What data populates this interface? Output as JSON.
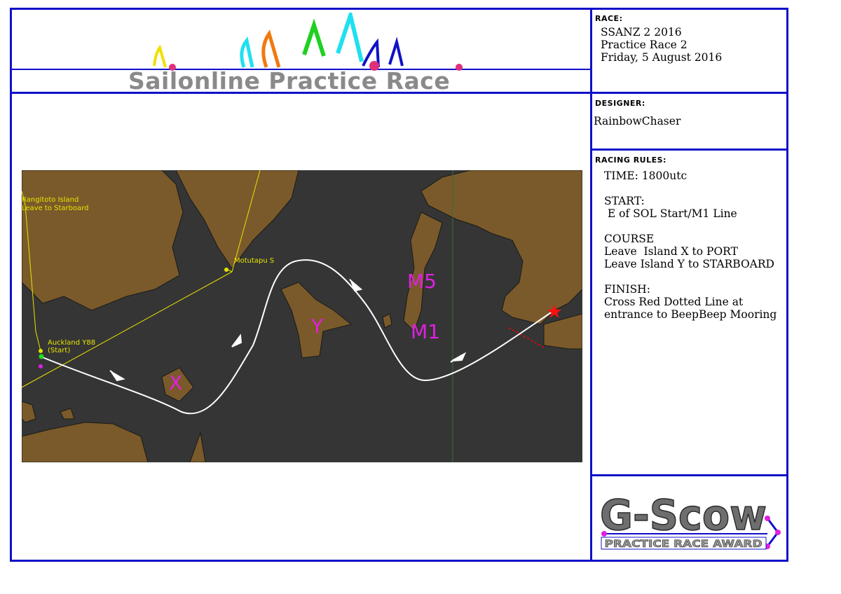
{
  "banner": {
    "title": "Sailonline Practice Race"
  },
  "race": {
    "heading": "RACE:",
    "line1": "SSANZ 2 2016",
    "line2": "Practice Race 2",
    "line3": "Friday, 5 August 2016"
  },
  "designer": {
    "heading": "DESIGNER:",
    "name": "RainbowChaser"
  },
  "rules": {
    "heading": "RACING RULES:",
    "time": "TIME: 1800utc",
    "start_label": "START:",
    "start_text": " E of SOL Start/M1 Line",
    "course_label": "COURSE",
    "course_line1": "Leave  Island X to PORT",
    "course_line2": "Leave Island Y to STARBOARD",
    "finish_label": "FINISH:",
    "finish_line1": "Cross Red Dotted Line at",
    "finish_line2": "entrance to BeepBeep Mooring"
  },
  "map": {
    "labels": {
      "rangitoto_1": "Rangitoto Island",
      "rangitoto_2": "Leave to Starboard",
      "motutapu": "Motutapu S",
      "auckland_1": "Auckland Y88",
      "auckland_2": "(Start)"
    },
    "marks": {
      "x": "X",
      "y": "Y",
      "m5": "M5",
      "m1": "M1"
    },
    "colors": {
      "water": "#353535",
      "land": "#7a5a2a",
      "route": "#ffffff",
      "marker": "#e020e0",
      "label": "#e8e400",
      "finish": "#ff0000"
    }
  },
  "award": {
    "logo_text": "G-Scow",
    "subtitle": "PRACTICE RACE AWARD"
  }
}
